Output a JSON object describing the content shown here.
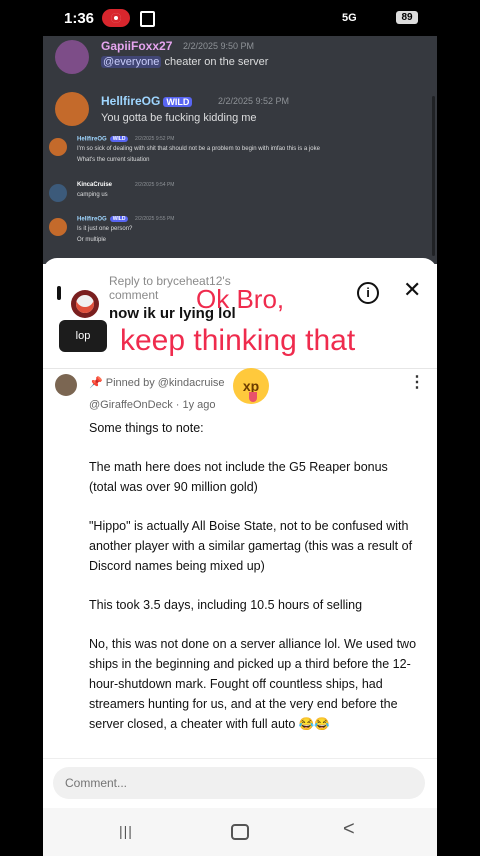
{
  "status_bar": {
    "time": "1:36",
    "network": "5G",
    "battery": "89"
  },
  "discord": {
    "messages": [
      {
        "user": "GapiiFoxx27",
        "timestamp": "2/2/2025 9:50 PM",
        "mention": "@everyone",
        "text": " cheater on the server"
      },
      {
        "user": "HellfireOG",
        "badge": "WILD",
        "timestamp": "2/2/2025 9:52 PM",
        "text": "You gotta be fucking kidding me"
      },
      {
        "user": "HellfireOG",
        "badge": "WILD",
        "timestamp": "2/2/2025 9:52 PM",
        "text": "I'm so sick of dealing with shit that should not be a problem to begin with imfao this is a joke",
        "text2": "What's the current situation"
      },
      {
        "user": "KincaCruise",
        "timestamp": "2/2/2025 9:54 PM",
        "text": "camping us"
      },
      {
        "user": "HellfireOG",
        "badge": "WILD",
        "timestamp": "2/2/2025 9:55 PM",
        "text": "Is it just one person?",
        "text2": "Or multiple"
      }
    ],
    "colors": {
      "bg": "#36393f",
      "mention": "#414675",
      "badge": "#5865f2"
    }
  },
  "reply_sheet": {
    "reply_label": "Reply to bryceheat12's comment",
    "reply_text": "now ik ur lying lol",
    "overlay_line1": "Ok Bro,",
    "overlay_line2": "keep thinking that",
    "pill_text": "lop",
    "overlay_color": "#ef2b4d"
  },
  "comment": {
    "pinned_by": "Pinned by @kindacruise",
    "handle": "@GiraffeOnDeck · 1y ago",
    "emoji": "xp",
    "paragraphs": [
      "Some things to note:",
      "The math here does not include the G5 Reaper bonus (total was over 90 million gold)",
      "\"Hippo\" is actually All Boise State, not to be confused with another player with a similar gamertag (this was a result of Discord names being mixed up)",
      "This took 3.5 days, including 10.5 hours of selling",
      "No, this was not done on a server alliance lol. We used two ships in the beginning and picked up a third before the 12-hour-shutdown mark. Fought off countless ships, had streamers hunting for us, and at the very end before the server closed, a cheater with full auto 😂😂"
    ]
  },
  "comment_input": {
    "placeholder": "Comment..."
  },
  "nav": {
    "recent": "|||",
    "back": "<"
  }
}
